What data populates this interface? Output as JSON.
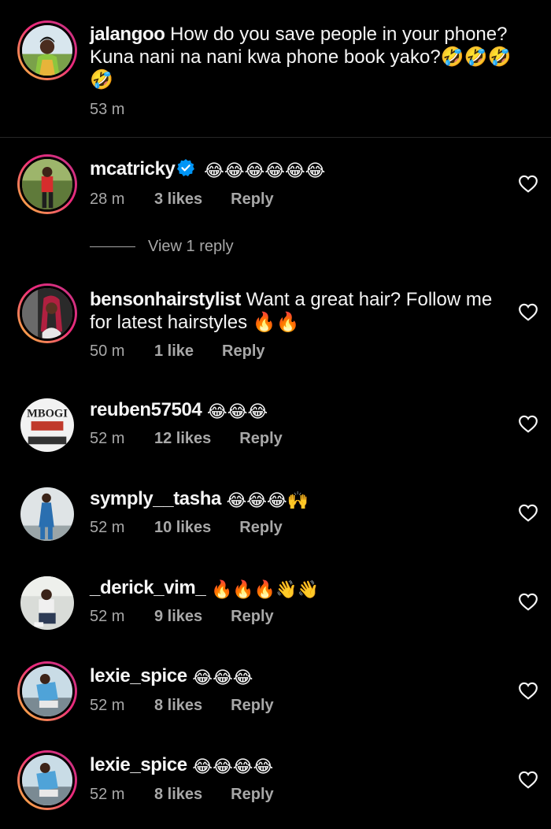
{
  "caption": {
    "username": "jalangoo",
    "text": "How do you save people in your phone? Kuna nani na nani kwa phone book yako?🤣🤣🤣🤣",
    "time": "53 m"
  },
  "comments": [
    {
      "username": "mcatricky",
      "text": "😂😂😂😂😂😂",
      "time": "28 m",
      "likes": "3 likes",
      "reply": "Reply",
      "verified": true
    },
    {
      "username": "bensonhairstylist",
      "text": "Want a great hair? Follow me for latest hairstyles 🔥🔥",
      "time": "50 m",
      "likes": "1 like",
      "reply": "Reply"
    },
    {
      "username": "reuben57504",
      "text": "😂😂😂",
      "time": "52 m",
      "likes": "12 likes",
      "reply": "Reply"
    },
    {
      "username": "symply__tasha",
      "text": "😂😂😂🙌",
      "time": "52 m",
      "likes": "10 likes",
      "reply": "Reply"
    },
    {
      "username": "_derick_vim_",
      "text": "🔥🔥🔥👋👋",
      "time": "52 m",
      "likes": "9 likes",
      "reply": "Reply"
    },
    {
      "username": "lexie_spice",
      "text": "😂😂😂",
      "time": "52 m",
      "likes": "8 likes",
      "reply": "Reply"
    },
    {
      "username": "lexie_spice",
      "text": "😂😂😂😂",
      "time": "52 m",
      "likes": "8 likes",
      "reply": "Reply"
    }
  ],
  "view_replies": "View 1 reply",
  "avatar_images": {
    "reuben57504": "MBOGI"
  },
  "icons": {
    "verified": "verified-badge-icon",
    "heart": "heart-outline-icon"
  },
  "colors": {
    "background": "#000000",
    "text": "#f5f5f5",
    "secondary": "#a8a8a8",
    "verified": "#0095f6",
    "divider": "#262626"
  }
}
